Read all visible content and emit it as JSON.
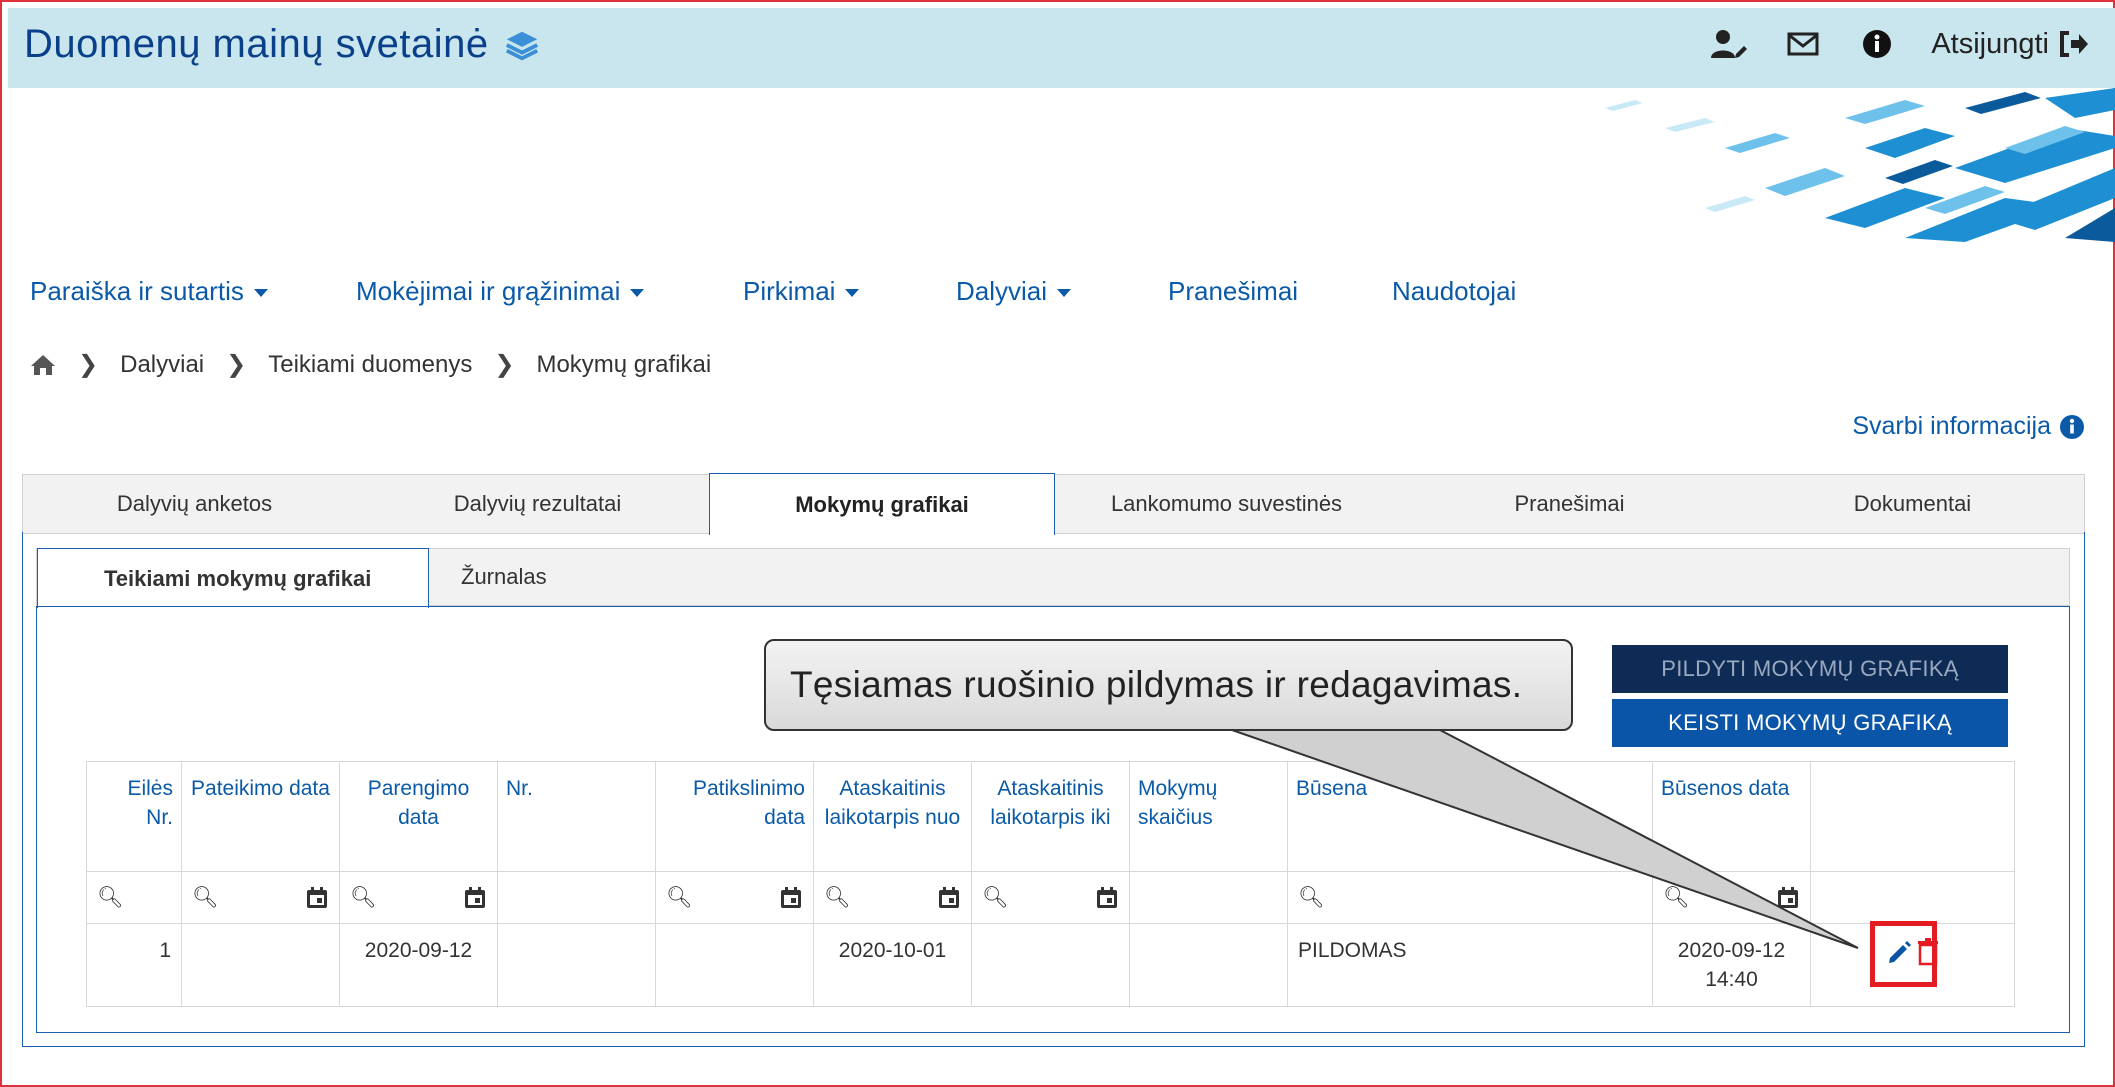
{
  "header": {
    "title": "Duomenų mainų svetainė",
    "logout_label": "Atsijungti"
  },
  "nav": [
    {
      "label": "Paraiška ir sutartis",
      "dropdown": true
    },
    {
      "label": "Mokėjimai ir grąžinimai",
      "dropdown": true
    },
    {
      "label": "Pirkimai",
      "dropdown": true
    },
    {
      "label": "Dalyviai",
      "dropdown": true
    },
    {
      "label": "Pranešimai",
      "dropdown": false
    },
    {
      "label": "Naudotojai",
      "dropdown": false
    }
  ],
  "breadcrumb": [
    "Dalyviai",
    "Teikiami duomenys",
    "Mokymų grafikai"
  ],
  "important_info": "Svarbi informacija",
  "tabs": [
    "Dalyvių anketos",
    "Dalyvių rezultatai",
    "Mokymų grafikai",
    "Lankomumo suvestinės",
    "Pranešimai",
    "Dokumentai"
  ],
  "active_tab": "Mokymų grafikai",
  "subtabs": [
    "Teikiami mokymų grafikai",
    "Žurnalas"
  ],
  "buttons": {
    "fill": "PILDYTI MOKYMŲ GRAFIKĄ",
    "edit": "KEISTI MOKYMŲ GRAFIKĄ"
  },
  "callout": "Tęsiamas ruošinio pildymas ir redagavimas.",
  "table": {
    "columns": [
      "Eilės Nr.",
      "Pateikimo data",
      "Parengimo data",
      "Nr.",
      "Patikslinimo data",
      "Ataskaitinis laikotarpis nuo",
      "Ataskaitinis laikotarpis iki",
      "Mokymų skaičius",
      "Būsena",
      "Būsenos data",
      ""
    ],
    "rows": [
      {
        "eiles_nr": "1",
        "pateikimo_data": "",
        "parengimo_data": "2020-09-12",
        "nr": "",
        "patikslinimo_data": "",
        "laikotarpis_nuo": "2020-10-01",
        "laikotarpis_iki": "",
        "mokymu_skaicius": "",
        "busena": "PILDOMAS",
        "busenos_data": "2020-09-12 14:40"
      }
    ]
  },
  "colors": {
    "header_bg": "#c9e6ee",
    "brand_blue": "#0a3f8a",
    "link_blue": "#0b5aa8",
    "button_dark": "#0d2b55",
    "button_blue": "#0b55a8",
    "highlight_red": "#e31b23"
  }
}
